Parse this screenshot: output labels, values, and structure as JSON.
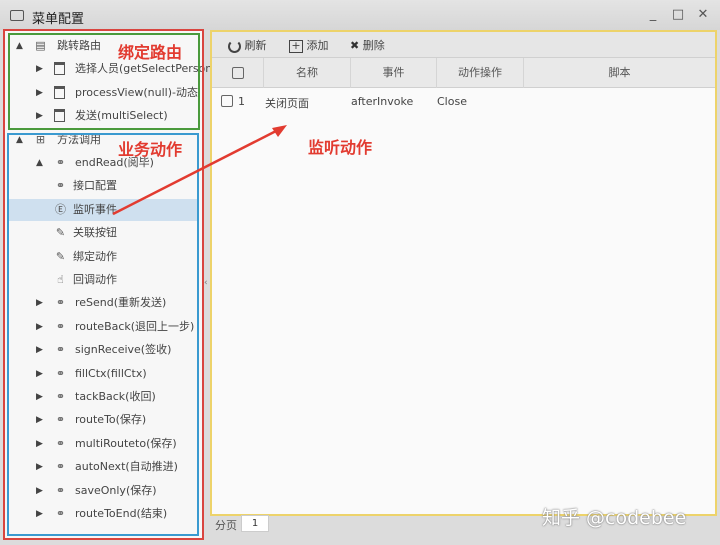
{
  "window": {
    "title": "菜单配置",
    "minimize": "_",
    "maximize": "□",
    "close": "✕"
  },
  "tree": [
    {
      "label": "跳转路由",
      "level": 0,
      "toggle": "▲",
      "icon": "route-icon"
    },
    {
      "label": "选择人员(getSelectPerson)",
      "level": 1,
      "toggle": "▶",
      "icon": "page-icon"
    },
    {
      "label": "processView(null)-动态",
      "level": 1,
      "toggle": "▶",
      "icon": "page-icon"
    },
    {
      "label": "发送(multiSelect)",
      "level": 1,
      "toggle": "▶",
      "icon": "page-icon"
    },
    {
      "label": "方法调用",
      "level": 0,
      "toggle": "▲",
      "icon": "method-icon"
    },
    {
      "label": "endRead(阅毕)",
      "level": 1,
      "toggle": "▲",
      "icon": "link-icon"
    },
    {
      "label": "接口配置",
      "level": 2,
      "icon": "link-icon"
    },
    {
      "label": "监听事件",
      "level": 2,
      "icon": "event-icon",
      "selected": true
    },
    {
      "label": "关联按钮",
      "level": 2,
      "icon": "edit-icon"
    },
    {
      "label": "绑定动作",
      "level": 2,
      "icon": "edit-icon"
    },
    {
      "label": "回调动作",
      "level": 2,
      "icon": "pointer-icon"
    },
    {
      "label": "reSend(重新发送)",
      "level": 1,
      "toggle": "▶",
      "icon": "link-icon"
    },
    {
      "label": "routeBack(退回上一步)",
      "level": 1,
      "toggle": "▶",
      "icon": "link-icon"
    },
    {
      "label": "signReceive(签收)",
      "level": 1,
      "toggle": "▶",
      "icon": "link-icon"
    },
    {
      "label": "fillCtx(fillCtx)",
      "level": 1,
      "toggle": "▶",
      "icon": "link-icon"
    },
    {
      "label": "tackBack(收回)",
      "level": 1,
      "toggle": "▶",
      "icon": "link-icon"
    },
    {
      "label": "routeTo(保存)",
      "level": 1,
      "toggle": "▶",
      "icon": "link-icon"
    },
    {
      "label": "multiRouteto(保存)",
      "level": 1,
      "toggle": "▶",
      "icon": "link-icon"
    },
    {
      "label": "autoNext(自动推进)",
      "level": 1,
      "toggle": "▶",
      "icon": "link-icon"
    },
    {
      "label": "saveOnly(保存)",
      "level": 1,
      "toggle": "▶",
      "icon": "link-icon"
    },
    {
      "label": "routeToEnd(结束)",
      "level": 1,
      "toggle": "▶",
      "icon": "link-icon"
    }
  ],
  "annotations": {
    "route": "绑定路由",
    "business": "业务动作",
    "listen": "监听动作"
  },
  "toolbar": {
    "refresh": "刷新",
    "add": "添加",
    "delete": "删除"
  },
  "table": {
    "columns": [
      "名称",
      "事件",
      "动作操作",
      "脚本"
    ],
    "rows": [
      {
        "index": "1",
        "name": "关闭页面",
        "event": "afterInvoke",
        "action": "Close",
        "script": ""
      }
    ]
  },
  "pager": {
    "label": "分页",
    "page": "1"
  },
  "watermark": "知乎 @codebee",
  "colors": {
    "red": "#d9453f",
    "green": "#4a9a3c",
    "blue": "#3a9ad0",
    "yellow": "#edd36a"
  }
}
